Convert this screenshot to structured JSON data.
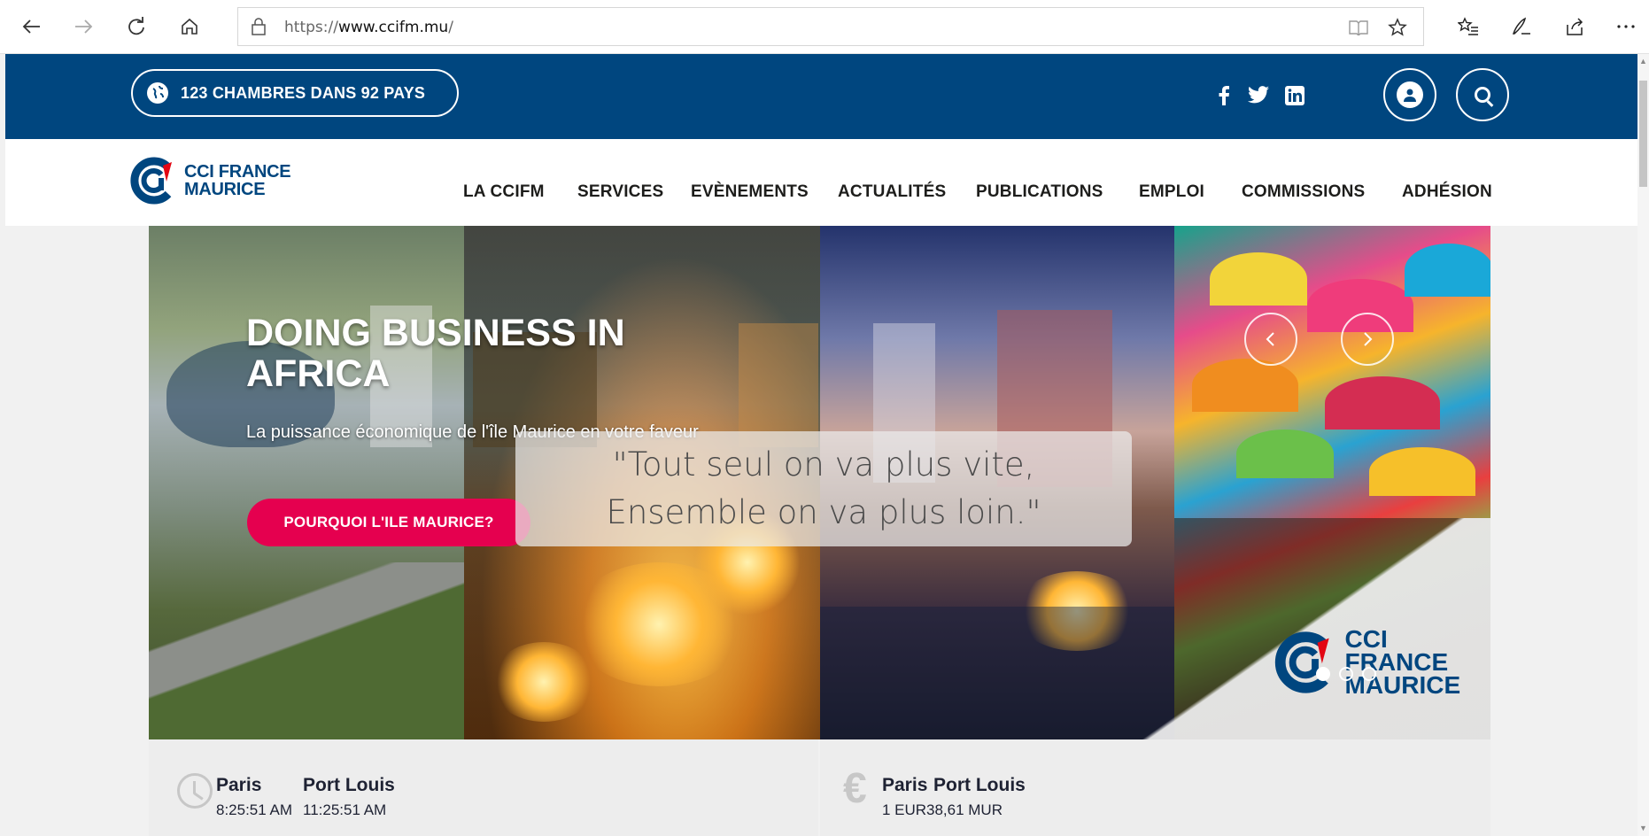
{
  "browser": {
    "url_prefix": "https://",
    "url_domain": "www.ccifm.mu",
    "url_suffix": "/",
    "icons": [
      "back-arrow-icon",
      "forward-arrow-icon",
      "refresh-icon",
      "home-icon",
      "lock-icon",
      "reading-view-icon",
      "favorite-star-icon",
      "favorites-list-icon",
      "pen-notes-icon",
      "share-icon",
      "more-icon"
    ]
  },
  "topbar": {
    "chambres_label": "123 CHAMBRES DANS 92 PAYS",
    "social": [
      "f",
      "t",
      "in"
    ]
  },
  "nav": {
    "logo_line1": "CCI FRANCE",
    "logo_line2": "MAURICE",
    "items": [
      "LA CCIFM",
      "SERVICES",
      "EVÈNEMENTS",
      "ACTUALITÉS",
      "PUBLICATIONS",
      "EMPLOI",
      "COMMISSIONS",
      "ADHÉSION"
    ]
  },
  "hero": {
    "title": "DOING BUSINESS IN AFRICA",
    "subtitle": "La puissance économique de l'île Maurice en votre faveur",
    "cta": "POURQUOI L'ILE MAURICE?",
    "quote_line1": "\"Tout seul on va plus vite,",
    "quote_line2": "Ensemble on va plus loin.\"",
    "corner_logo_line1": "CCI FRANCE",
    "corner_logo_line2": "MAURICE",
    "slide_count": 3,
    "active_slide": 1
  },
  "info": {
    "time": {
      "city1": "Paris",
      "city2": "Port Louis",
      "time1": "8:25:51 AM",
      "time2": "11:25:51 AM"
    },
    "currency": {
      "city1": "Paris",
      "city2": "Port Louis",
      "value1": "1 EUR",
      "value2": "38,61 MUR"
    }
  },
  "colors": {
    "brand_blue": "#00467f",
    "cta_pink": "#e5004f",
    "logo_red": "#e30613"
  }
}
